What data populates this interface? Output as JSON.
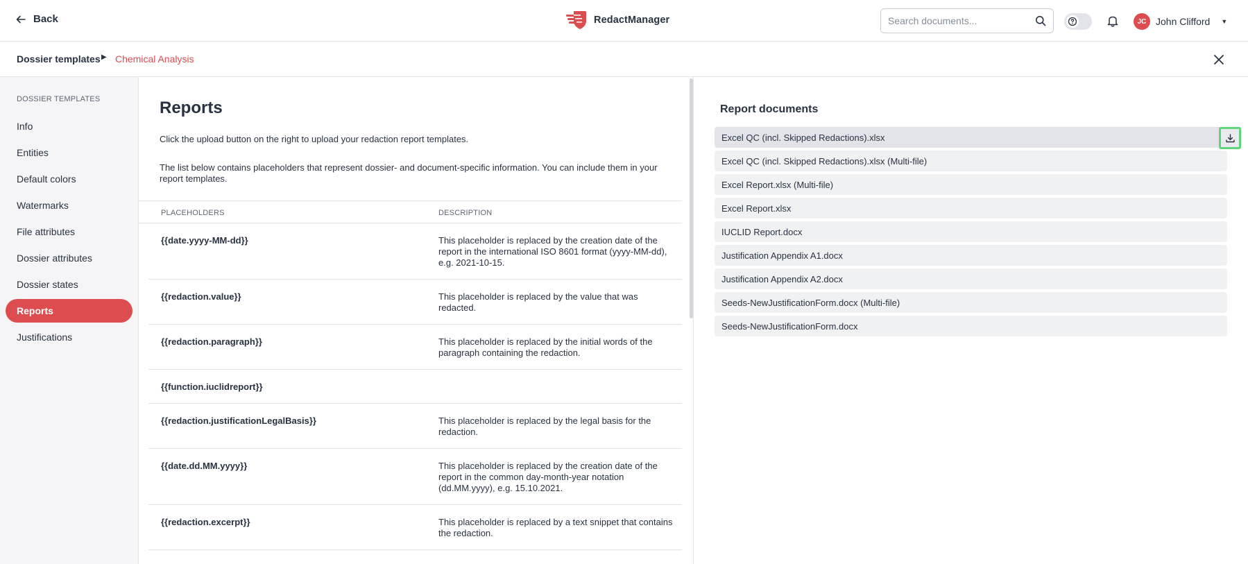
{
  "topbar": {
    "back_label": "Back",
    "brand_name": "RedactManager",
    "search_placeholder": "Search documents...",
    "user_initials": "JC",
    "user_name": "John Clifford"
  },
  "breadcrumb": {
    "parent": "Dossier templates",
    "current": "Chemical Analysis"
  },
  "sidebar": {
    "section_title": "DOSSIER TEMPLATES",
    "items": [
      {
        "label": "Info"
      },
      {
        "label": "Entities"
      },
      {
        "label": "Default colors"
      },
      {
        "label": "Watermarks"
      },
      {
        "label": "File attributes"
      },
      {
        "label": "Dossier attributes"
      },
      {
        "label": "Dossier states"
      },
      {
        "label": "Reports",
        "active": true
      },
      {
        "label": "Justifications"
      }
    ]
  },
  "main": {
    "title": "Reports",
    "intro": "Click the upload button on the right to upload your redaction report templates.",
    "intro2": "The list below contains placeholders that represent dossier- and document-specific information. You can include them in your report templates.",
    "columns": [
      "PLACEHOLDERS",
      "DESCRIPTION"
    ],
    "rows": [
      {
        "placeholder": "{{date.yyyy-MM-dd}}",
        "description": "This placeholder is replaced by the creation date of the report in the international ISO 8601 format (yyyy-MM-dd), e.g. 2021-10-15."
      },
      {
        "placeholder": "{{redaction.value}}",
        "description": "This placeholder is replaced by the value that was redacted."
      },
      {
        "placeholder": "{{redaction.paragraph}}",
        "description": "This placeholder is replaced by the initial words of the paragraph containing the redaction."
      },
      {
        "placeholder": "{{function.iuclidreport}}",
        "description": ""
      },
      {
        "placeholder": "{{redaction.justificationLegalBasis}}",
        "description": "This placeholder is replaced by the legal basis for the redaction."
      },
      {
        "placeholder": "{{date.dd.MM.yyyy}}",
        "description": "This placeholder is replaced by the creation date of the report in the common day-month-year notation (dd.MM.yyyy), e.g. 15.10.2021."
      },
      {
        "placeholder": "{{redaction.excerpt}}",
        "description": "This placeholder is replaced by a text snippet that contains the redaction."
      }
    ]
  },
  "report_documents": {
    "title": "Report documents",
    "items": [
      "Excel QC (incl. Skipped Redactions).xlsx",
      "Excel QC (incl. Skipped Redactions).xlsx (Multi-file)",
      "Excel Report.xlsx (Multi-file)",
      "Excel Report.xlsx",
      "IUCLID Report.docx",
      "Justification Appendix A1.docx",
      "Justification Appendix A2.docx",
      "Seeds-NewJustificationForm.docx (Multi-file)",
      "Seeds-NewJustificationForm.docx"
    ]
  },
  "colors": {
    "accent": "#dd4d50",
    "highlight": "#5fd47a"
  }
}
